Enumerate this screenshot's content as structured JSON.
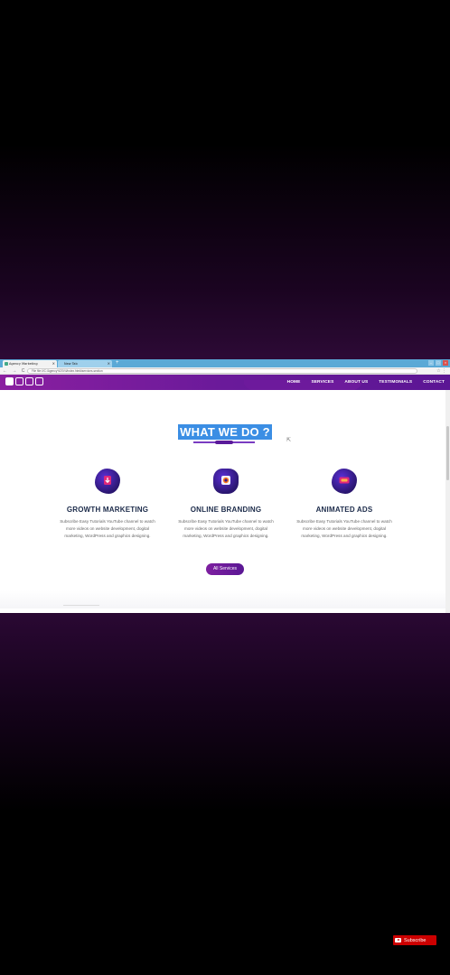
{
  "browser": {
    "tabs": [
      {
        "label": "Agency Marketing"
      },
      {
        "label": "New Tab"
      }
    ],
    "new_tab": "+",
    "address": "File   file:///C:/Agency%20V4/index.html#services-section",
    "nav_buttons": "← → C",
    "right_icons": "☆ ⋮"
  },
  "site": {
    "nav": {
      "items": [
        "HOME",
        "SERVICES",
        "ABOUT US",
        "TESTIMONIALS",
        "CONTACT"
      ]
    },
    "section": {
      "heading": "WHAT WE DO ?",
      "services": [
        {
          "icon": "download-arrow-icon",
          "title": "GROWTH MARKETING",
          "description": "Subscribe Easy Tutorials YouTube channel to watch more videos on website development, dogital marketing, WordPress and graphics designing."
        },
        {
          "icon": "camera-lens-icon",
          "title": "ONLINE BRANDING",
          "description": "Subscribe Easy Tutorials YouTube channel to watch more videos on website development, dogital marketing, WordPress and graphics designing."
        },
        {
          "icon": "screen-ad-icon",
          "title": "ANIMATED ADS",
          "description": "Subscribe Easy Tutorials YouTube channel to watch more videos on website development, dogital marketing, WordPress and graphics designing."
        }
      ],
      "button_label": "All Services"
    }
  },
  "overlay": {
    "subscribe_label": "Subscribe"
  },
  "colors": {
    "nav_gradient_start": "#8a1fa0",
    "nav_gradient_end": "#5b1694",
    "heading_highlight": "#3b8ee4",
    "title_text": "#1c2b4a",
    "subscribe_red": "#cc0000"
  }
}
